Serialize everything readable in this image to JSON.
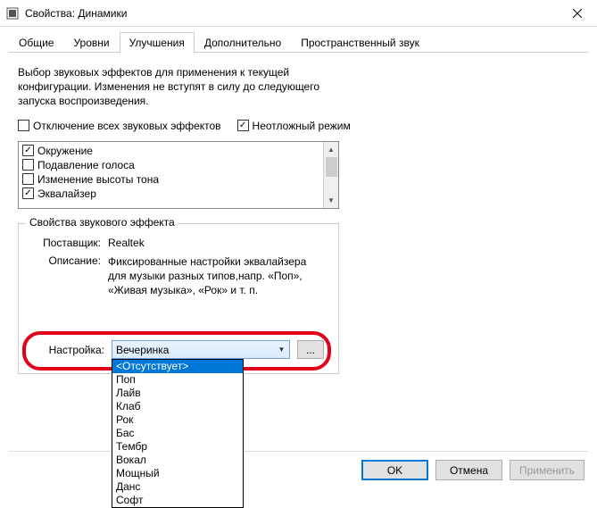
{
  "window": {
    "title": "Свойства: Динамики"
  },
  "tabs": {
    "general": "Общие",
    "levels": "Уровни",
    "enhancements": "Улучшения",
    "advanced": "Дополнительно",
    "spatial": "Пространственный звук"
  },
  "intro": "Выбор звуковых эффектов для применения к текущей конфигурации. Изменения не вступят в силу до следующего запуска воспроизведения.",
  "checks": {
    "disable_all": "Отключение всех звуковых эффектов",
    "immediate": "Неотложный режим"
  },
  "effects": [
    {
      "label": "Окружение",
      "checked": true
    },
    {
      "label": "Подавление голоса",
      "checked": false
    },
    {
      "label": "Изменение высоты тона",
      "checked": false
    },
    {
      "label": "Эквалайзер",
      "checked": true
    }
  ],
  "props": {
    "legend": "Свойства звукового эффекта",
    "provider_label": "Поставщик:",
    "provider_value": "Realtek",
    "desc_label": "Описание:",
    "desc_value": "Фиксированные настройки эквалайзера для музыки разных типов,напр. «Поп», «Живая музыка», «Рок» и т. п."
  },
  "setting": {
    "label": "Настройка:",
    "selected": "Вечеринка",
    "options": [
      "<Отсутствует>",
      "Поп",
      "Лайв",
      "Клаб",
      "Рок",
      "Бас",
      "Тембр",
      "Вокал",
      "Мощный",
      "Данс",
      "Софт"
    ],
    "highlight_index": 0,
    "ellipsis": "..."
  },
  "buttons": {
    "ok": "OK",
    "cancel": "Отмена",
    "apply": "Применить"
  }
}
